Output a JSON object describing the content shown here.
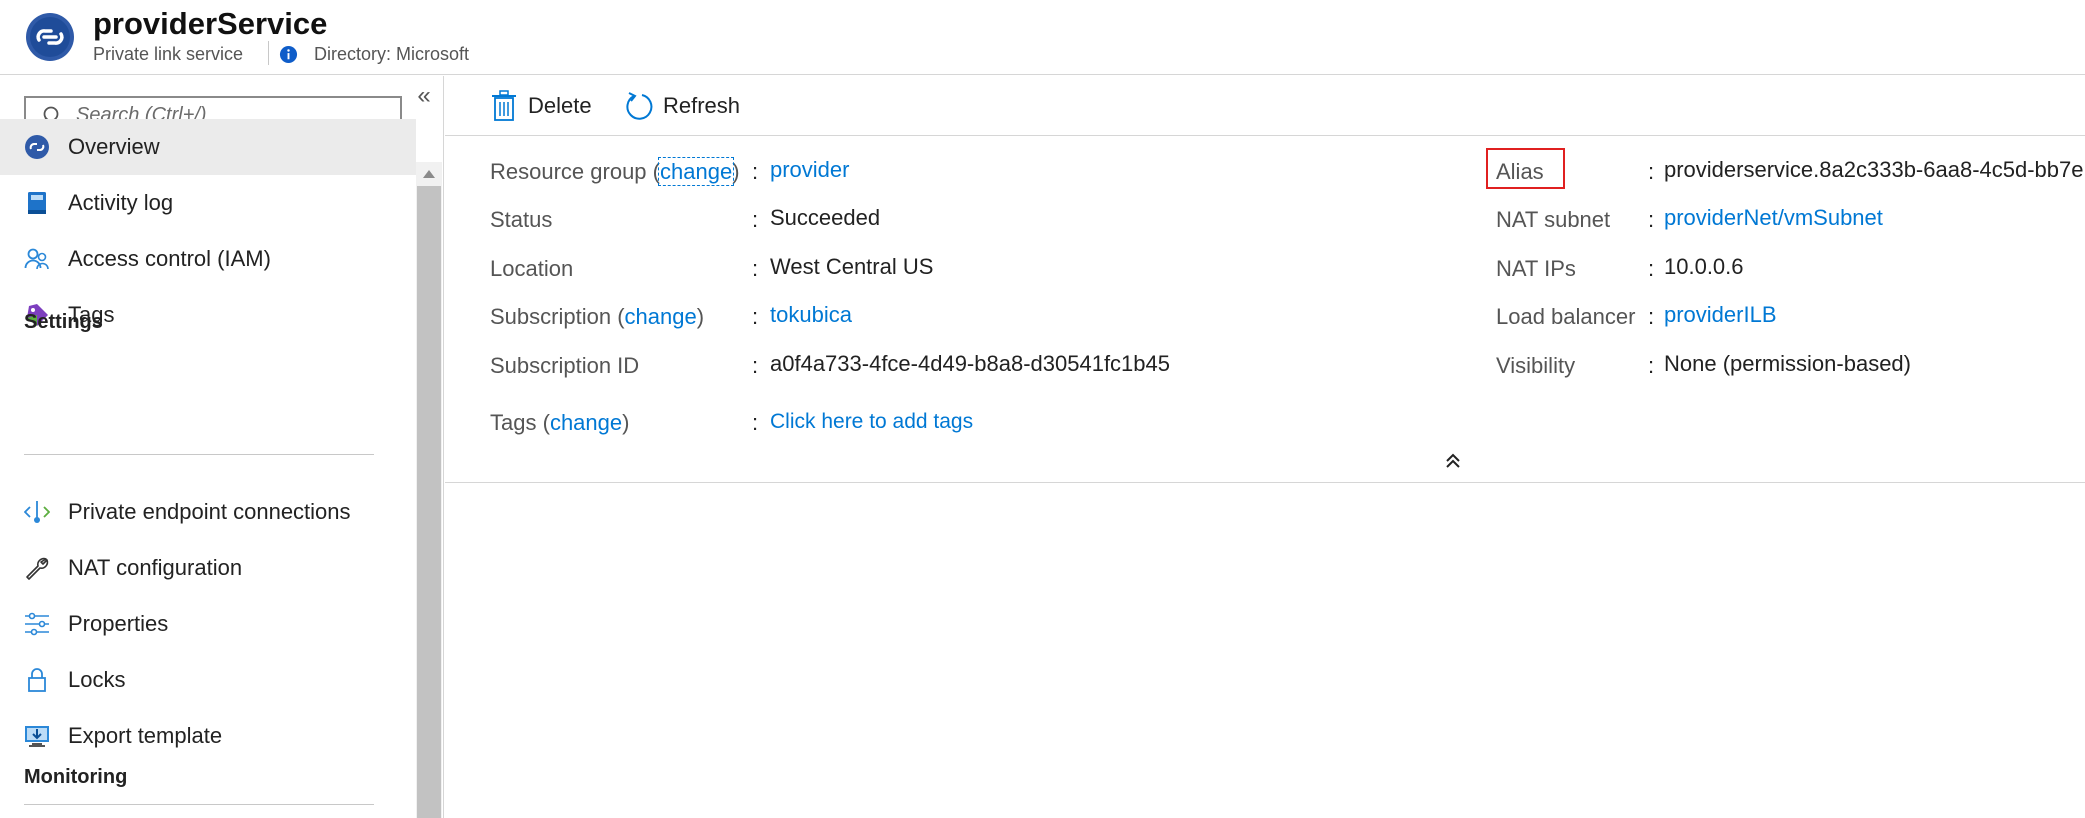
{
  "header": {
    "title": "providerService",
    "subtitle": "Private link service",
    "directory": "Directory: Microsoft",
    "icon": "private-link-service-icon",
    "info_icon": "info-icon"
  },
  "sidebar": {
    "search_placeholder": "Search (Ctrl+/)",
    "collapse_glyph": "«",
    "items": [
      {
        "label": "Overview",
        "icon": "overview-icon",
        "active": true
      },
      {
        "label": "Activity log",
        "icon": "activity-log-icon"
      },
      {
        "label": "Access control (IAM)",
        "icon": "access-control-icon"
      },
      {
        "label": "Tags",
        "icon": "tag-icon"
      }
    ],
    "settings_title": "Settings",
    "settings_items": [
      {
        "label": "Private endpoint connections",
        "icon": "private-endpoint-icon"
      },
      {
        "label": "NAT configuration",
        "icon": "wrench-icon"
      },
      {
        "label": "Properties",
        "icon": "properties-icon"
      },
      {
        "label": "Locks",
        "icon": "lock-icon"
      },
      {
        "label": "Export template",
        "icon": "export-template-icon"
      }
    ],
    "monitoring_title": "Monitoring"
  },
  "toolbar": {
    "delete_label": "Delete",
    "refresh_label": "Refresh"
  },
  "essentials": {
    "change_text": "change",
    "left": {
      "resource_group_label": "Resource group",
      "resource_group_value": "provider",
      "status_label": "Status",
      "status_value": "Succeeded",
      "location_label": "Location",
      "location_value": "West Central US",
      "subscription_label": "Subscription",
      "subscription_value": "tokubica",
      "subscription_id_label": "Subscription ID",
      "subscription_id_value": "a0f4a733-4fce-4d49-b8a8-d30541fc1b45",
      "tags_label": "Tags",
      "tags_value": "Click here to add tags"
    },
    "right": {
      "alias_label": "Alias",
      "alias_value": "providerservice.8a2c333b-6aa8-4c5d-bb7e",
      "nat_subnet_label": "NAT subnet",
      "nat_subnet_value": "providerNet/vmSubnet",
      "nat_ips_label": "NAT IPs",
      "nat_ips_value": "10.0.0.6",
      "load_balancer_label": "Load balancer",
      "load_balancer_value": "providerILB",
      "visibility_label": "Visibility",
      "visibility_value": "None (permission-based)"
    },
    "colon": ":",
    "open_paren": "(",
    "close_paren": ")"
  },
  "colors": {
    "link": "#0078d4",
    "highlight_box": "#e02020",
    "active_nav": "#ebebeb"
  }
}
